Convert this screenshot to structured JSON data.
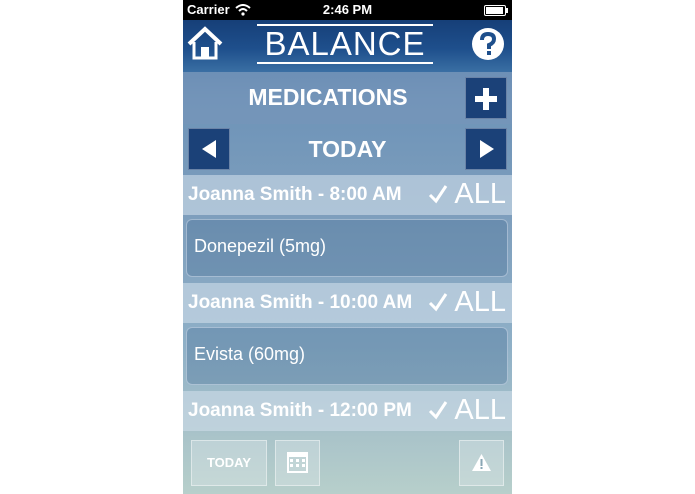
{
  "status_bar": {
    "carrier": "Carrier",
    "time": "2:46 PM"
  },
  "header": {
    "logo": "BALANCE",
    "icons": {
      "home": "home-icon",
      "help": "help-icon"
    }
  },
  "title_bar": {
    "title": "MEDICATIONS",
    "add_icon": "plus-icon"
  },
  "day_nav": {
    "label": "TODAY",
    "prev_icon": "arrow-left-icon",
    "next_icon": "arrow-right-icon"
  },
  "schedule": [
    {
      "header": "Joanna Smith - 8:00 AM",
      "all_label": "ALL",
      "medications": [
        "Donepezil (5mg)"
      ]
    },
    {
      "header": "Joanna Smith - 10:00 AM",
      "all_label": "ALL",
      "medications": [
        "Evista (60mg)"
      ]
    },
    {
      "header": "Joanna Smith - 12:00 PM",
      "all_label": "ALL",
      "medications": []
    }
  ],
  "toolbar": {
    "today_label": "TODAY",
    "calendar_icon": "calendar-icon",
    "alert_icon": "warning-icon"
  },
  "colors": {
    "header_bg": "#1e4f8c",
    "button_bg": "#1b4178",
    "text": "#ffffff"
  }
}
